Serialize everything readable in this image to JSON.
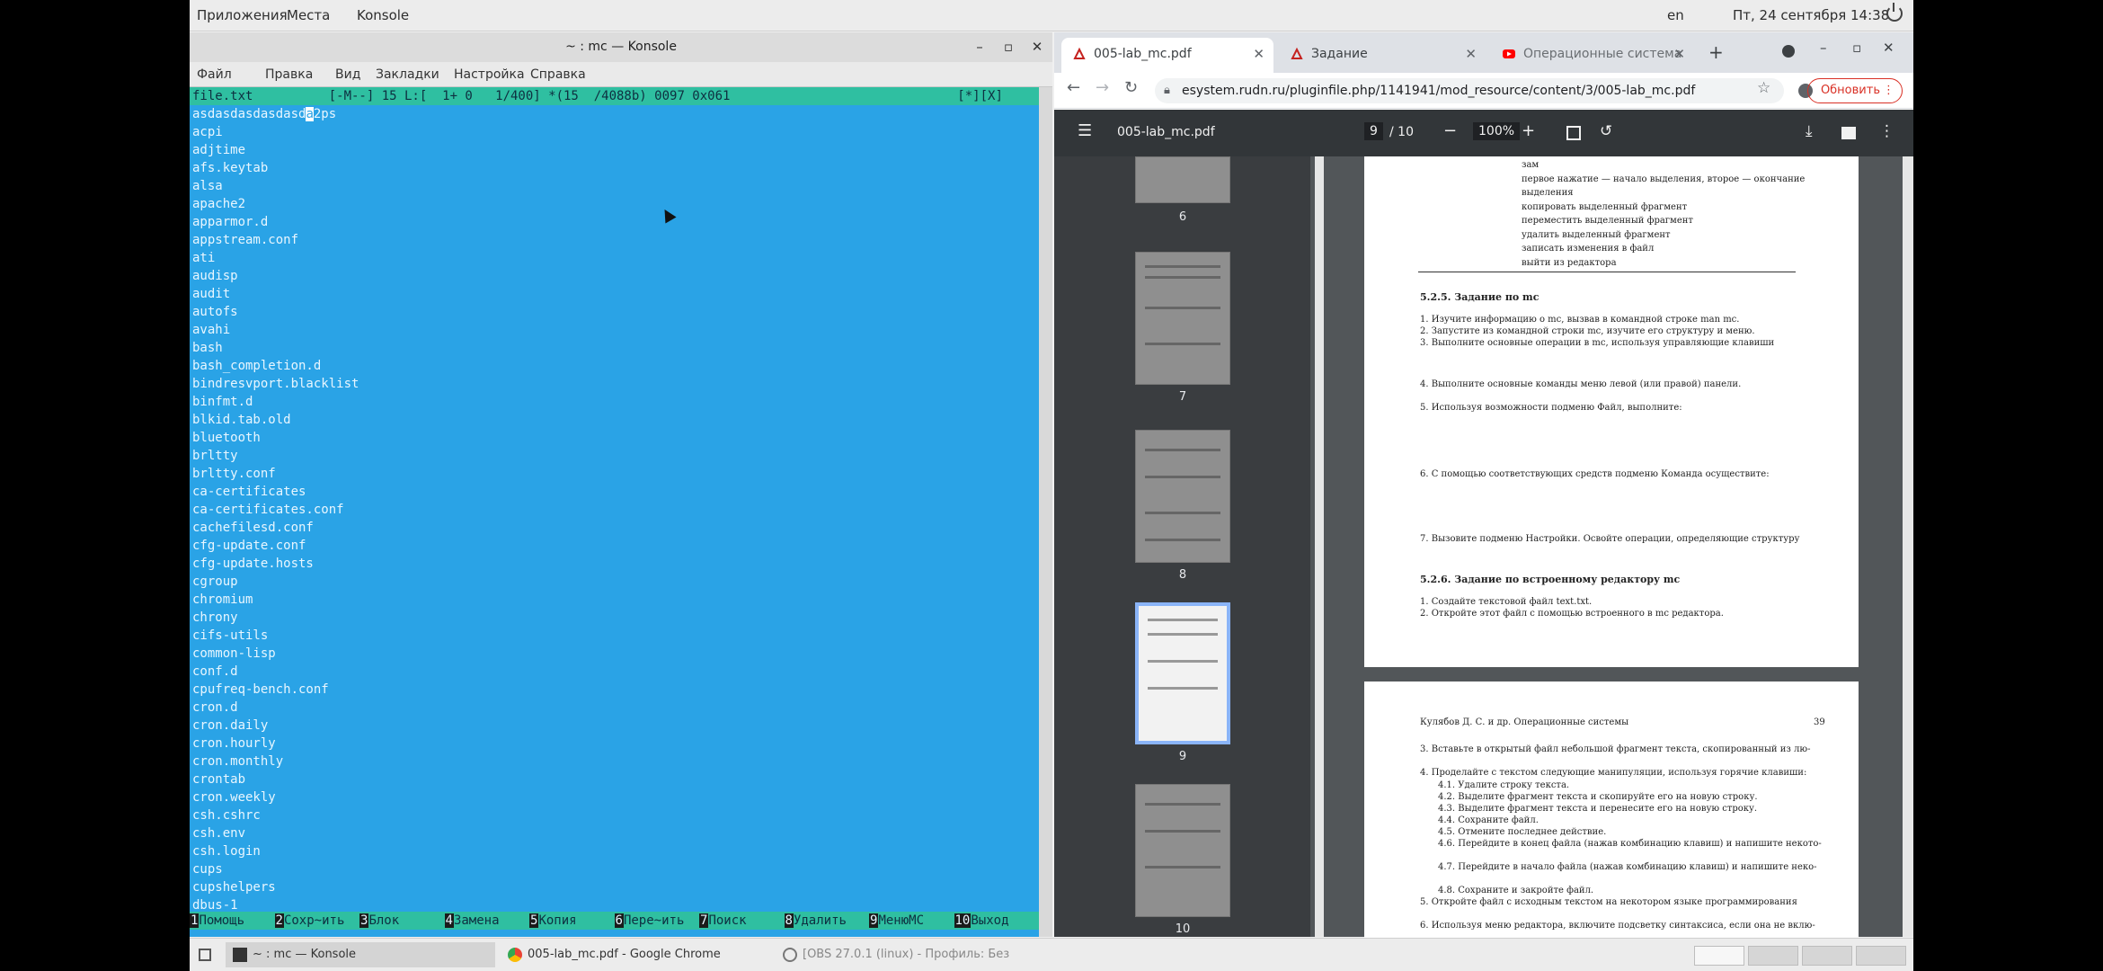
{
  "topbar": {
    "apps": "Приложения",
    "places": "Места",
    "active_app": "Konsole",
    "lang": "en",
    "clock": "Пт, 24 сентября 14:38"
  },
  "konsole": {
    "title": "~ : mc — Konsole",
    "menu": [
      "Файл",
      "Правка",
      "Вид",
      "Закладки",
      "Настройка",
      "Справка"
    ],
    "status_line": "file.txt          [-M--] 15 L:[  1+ 0   1/400] *(15  /4088b) 0097 0x061                              [*][X]",
    "first_line_before_cursor": "asdasdasdasdasd",
    "cursor_char": "a",
    "first_line_after_cursor": "2ps",
    "lines": [
      "acpi",
      "adjtime",
      "afs.keytab",
      "alsa",
      "apache2",
      "apparmor.d",
      "appstream.conf",
      "ati",
      "audisp",
      "audit",
      "autofs",
      "avahi",
      "bash",
      "bash_completion.d",
      "bindresvport.blacklist",
      "binfmt.d",
      "blkid.tab.old",
      "bluetooth",
      "brltty",
      "brltty.conf",
      "ca-certificates",
      "ca-certificates.conf",
      "cachefilesd.conf",
      "cfg-update.conf",
      "cfg-update.hosts",
      "cgroup",
      "chromium",
      "chrony",
      "cifs-utils",
      "common-lisp",
      "conf.d",
      "cpufreq-bench.conf",
      "cron.d",
      "cron.daily",
      "cron.hourly",
      "cron.monthly",
      "crontab",
      "cron.weekly",
      "csh.cshrc",
      "csh.env",
      "csh.login",
      "cups",
      "cupshelpers",
      "dbus-1"
    ],
    "fkeys": [
      {
        "num": "1",
        "label": "Помощь"
      },
      {
        "num": "2",
        "label": "Сохр~ить"
      },
      {
        "num": "3",
        "label": "Блок"
      },
      {
        "num": "4",
        "label": "Замена"
      },
      {
        "num": "5",
        "label": "Копия"
      },
      {
        "num": "6",
        "label": "Пере~ить"
      },
      {
        "num": "7",
        "label": "Поиск"
      },
      {
        "num": "8",
        "label": "Удалить"
      },
      {
        "num": "9",
        "label": "МенюMC"
      },
      {
        "num": "10",
        "label": "Выход"
      }
    ]
  },
  "chrome": {
    "tabs": [
      {
        "label": "005-lab_mc.pdf",
        "active": true
      },
      {
        "label": "Задание",
        "active": false
      },
      {
        "label": "Операционные система",
        "active": false
      }
    ],
    "url": "esystem.rudn.ru/pluginfile.php/1141941/mod_resource/content/3/005-lab_mc.pdf",
    "update_label": "Обновить",
    "pdf": {
      "filename": "005-lab_mc.pdf",
      "page_current": "9",
      "page_total": "/ 10",
      "zoom": "100%",
      "thumb_numbers": [
        "6",
        "7",
        "8",
        "9",
        "10"
      ],
      "page1_lines": [
        "зам",
        "первое нажатие — начало выделения, второе — окончание",
        "выделения",
        "копировать выделенный фрагмент",
        "переместить выделенный фрагмент",
        "удалить выделенный фрагмент",
        "записать изменения в файл",
        "выйти из редактора"
      ],
      "page1_heading1": "5.2.5.   Задание по mc",
      "page1_items1": [
        "1. Изучите информацию о mc, вызвав в командной строке man mc.",
        "2. Запустите из командной строки mc, изучите его структуру и меню.",
        "3. Выполните основные операции в mc, используя управляющие клавиши",
        "4. Выполните основные команды меню левой (или правой) панели.",
        "5. Используя возможности подменю Файл, выполните:",
        "6. С помощью соответствующих средств подменю Команда осуществите:",
        "7. Вызовите подменю Настройки. Освойте операции, определяющие структуру"
      ],
      "page1_heading2": "5.2.6.   Задание по встроенному редактору mc",
      "page1_items2": [
        "1. Создайте текстовой файл text.txt.",
        "2. Откройте этот файл с помощью встроенного в mc редактора."
      ],
      "page2_header": "Кулябов Д. С. и др. Операционные системы",
      "page2_pagenum": "39",
      "page2_lines": [
        "3. Вставьте в открытый файл небольшой фрагмент текста, скопированный из лю-",
        "4. Проделайте с текстом следующие манипуляции, используя горячие клавиши:",
        "4.1. Удалите строку текста.",
        "4.2. Выделите фрагмент текста и скопируйте его на новую строку.",
        "4.3. Выделите фрагмент текста и перенесите его на новую строку.",
        "4.4. Сохраните файл.",
        "4.5. Отмените последнее действие.",
        "4.6. Перейдите в конец файла (нажав комбинацию клавиш) и напишите некото-",
        "4.7. Перейдите в начало файла (нажав комбинацию клавиш) и напишите неко-",
        "4.8. Сохраните и закройте файл.",
        "5. Откройте файл с исходным текстом на некотором языке программирования",
        "6. Используя меню редактора, включите подсветку синтаксиса, если она не вклю-"
      ]
    }
  },
  "taskbar": {
    "tasks": [
      "~ : mc — Konsole",
      "005-lab_mc.pdf - Google Chrome",
      "[OBS 27.0.1 (linux) - Профиль: Без"
    ]
  },
  "colors": {
    "terminal_bg": "#2aa3e6",
    "mc_bar": "#2fbfa1",
    "pdf_toolbar": "#323639"
  }
}
